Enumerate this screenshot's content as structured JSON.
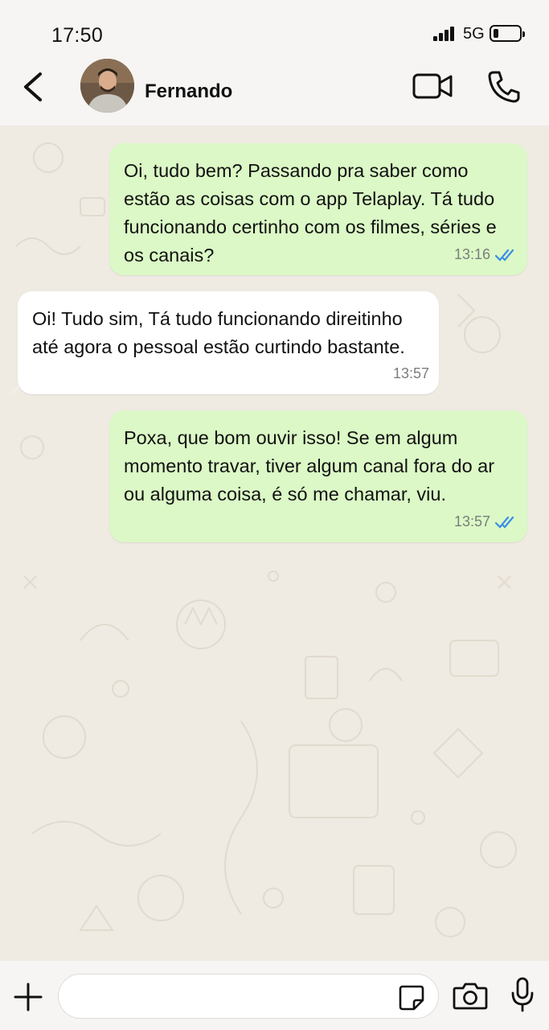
{
  "status_bar": {
    "time": "17:50",
    "network": "5G"
  },
  "header": {
    "contact_name": "Fernando"
  },
  "messages": [
    {
      "direction": "outgoing",
      "text": "Oi, tudo bem? Passando pra saber como estão as coisas com o app Telaplay. Tá tudo funcionando certinho com os filmes, séries e os canais?",
      "time": "13:16",
      "status": "read"
    },
    {
      "direction": "incoming",
      "text": "Oi! Tudo sim, Tá tudo funcionando direitinho até agora o pessoal estão curtindo bastante.",
      "time": "13:57"
    },
    {
      "direction": "outgoing",
      "text": "Poxa, que bom ouvir isso! Se em algum momento travar, tiver algum canal fora do ar ou alguma coisa, é só me chamar, viu.",
      "time": "13:57",
      "status": "read"
    }
  ],
  "composer": {
    "placeholder": ""
  },
  "colors": {
    "outgoing_bubble": "#dbf8c6",
    "incoming_bubble": "#ffffff",
    "read_ticks": "#3a8ee6",
    "chat_bg": "#efeae2"
  }
}
